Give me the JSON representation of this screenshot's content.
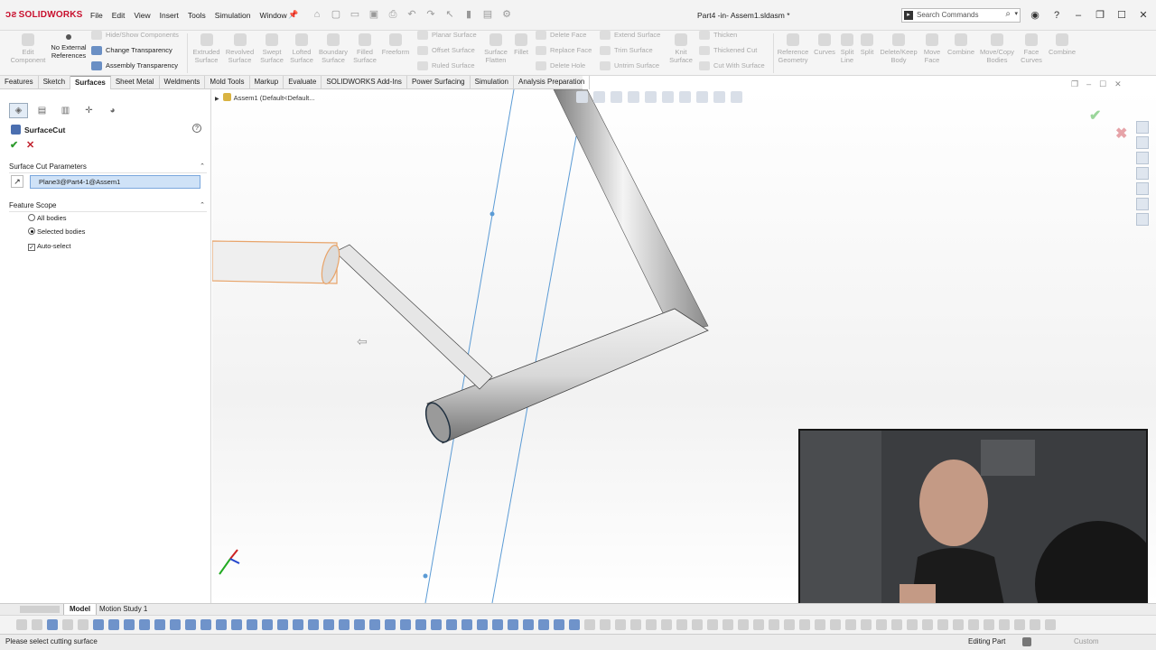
{
  "app": {
    "logo_text": "SOLIDWORKS",
    "document_title": "Part4 -in- Assem1.sldasm *"
  },
  "menu": [
    "File",
    "Edit",
    "View",
    "Insert",
    "Tools",
    "Simulation",
    "Window"
  ],
  "search": {
    "placeholder": "Search Commands"
  },
  "ribbon": {
    "edit_component": "Edit Component",
    "no_external_refs": "No External References",
    "hide_show_components": "Hide/Show Components",
    "change_transparency": "Change Transparency",
    "assembly_transparency": "Assembly Transparency",
    "extruded_surface": "Extruded Surface",
    "revolved_surface": "Revolved Surface",
    "swept_surface": "Swept Surface",
    "lofted_surface": "Lofted Surface",
    "boundary_surface": "Boundary Surface",
    "filled_surface": "Filled Surface",
    "freeform": "Freeform",
    "planar_surface": "Planar Surface",
    "offset_surface": "Offset Surface",
    "ruled_surface": "Ruled Surface",
    "surface_flatten": "Surface Flatten",
    "fillet": "Fillet",
    "delete_face": "Delete Face",
    "replace_face": "Replace Face",
    "delete_hole": "Delete Hole",
    "extend_surface": "Extend Surface",
    "trim_surface": "Trim Surface",
    "untrim_surface": "Untrim Surface",
    "knit_surface": "Knit Surface",
    "thicken": "Thicken",
    "thickened_cut": "Thickened Cut",
    "cut_with_surface": "Cut With Surface",
    "reference_geometry": "Reference Geometry",
    "curves": "Curves",
    "split_line": "Split Line",
    "split": "Split",
    "delete_keep_body": "Delete/Keep Body",
    "move_face": "Move Face",
    "combine1": "Combine",
    "move_copy_bodies": "Move/Copy Bodies",
    "face_curves": "Face Curves",
    "combine2": "Combine"
  },
  "tabs": [
    "Features",
    "Sketch",
    "Surfaces",
    "Sheet Metal",
    "Weldments",
    "Mold Tools",
    "Markup",
    "Evaluate",
    "SOLIDWORKS Add-Ins",
    "Power Surfacing",
    "Simulation",
    "Analysis Preparation"
  ],
  "active_tab": "Surfaces",
  "property_manager": {
    "title": "SurfaceCut",
    "section_params": "Surface Cut Parameters",
    "selection_value": "Plane3@Part4-1@Assem1",
    "section_scope": "Feature Scope",
    "option_all": "All bodies",
    "option_selected": "Selected bodies",
    "auto_select": "Auto-select",
    "selected_option": "Selected bodies",
    "auto_select_checked": true
  },
  "tree": {
    "root_label": "Assem1  (Default<Default..."
  },
  "bottom_tabs": {
    "model": "Model",
    "motion": "Motion Study 1"
  },
  "status": {
    "message": "Please select cutting surface",
    "mode": "Editing Part",
    "units": "Custom"
  },
  "colors": {
    "accent_red": "#c8102e",
    "selection_blue": "#cfe2f7",
    "plane_line": "#5b9bd5",
    "tube_edge_orange": "#e8a46a"
  }
}
